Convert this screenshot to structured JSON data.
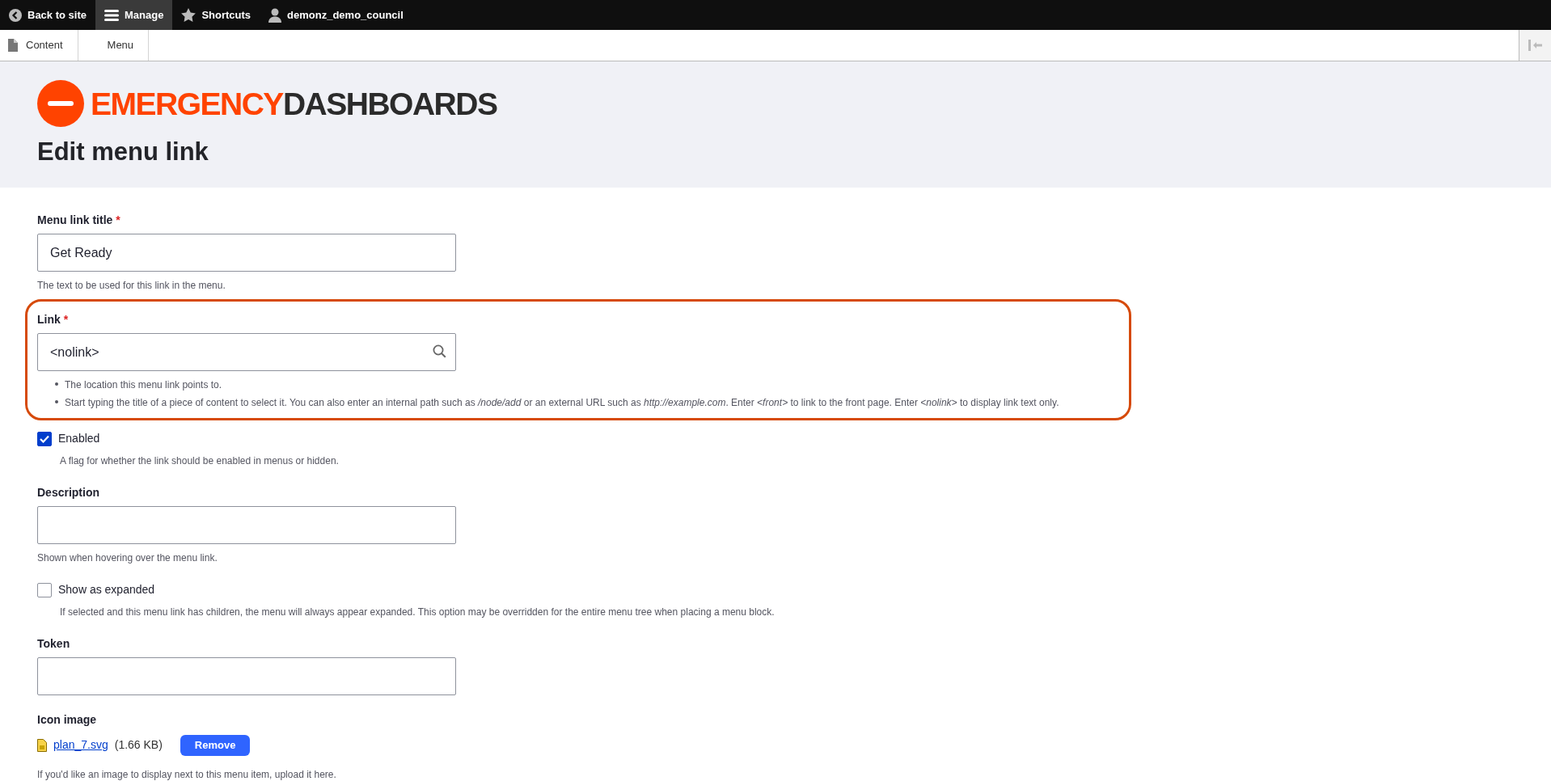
{
  "toolbar": {
    "items": [
      {
        "kind": "back",
        "label": "Back to site",
        "selected": false
      },
      {
        "kind": "menu",
        "label": "Manage",
        "selected": true
      },
      {
        "kind": "star",
        "label": "Shortcuts",
        "selected": false
      },
      {
        "kind": "user",
        "label": "demonz_demo_council",
        "selected": false
      }
    ]
  },
  "tray": {
    "items": [
      {
        "kind": "page",
        "label": "Content"
      },
      {
        "kind": "plain",
        "label": "Menu"
      }
    ]
  },
  "header": {
    "logo": {
      "parts": [
        {
          "text": "EMERGENCY",
          "color": "#ff4300"
        },
        {
          "text": "DASHBOARDS",
          "color": "#2b2b2b"
        }
      ]
    },
    "title": "Edit menu link"
  },
  "fields": [
    {
      "kind": "text",
      "label": "Menu link title",
      "required_mark": "*",
      "value": "Get Ready",
      "help": "The text to be used for this link in the menu."
    },
    {
      "kind": "text",
      "label": "Link",
      "required_mark": "*",
      "value": "<nolink>",
      "search": true,
      "highlighted": true,
      "help_items": [
        "The location this menu link points to.",
        "Start typing the title of a piece of content to select it. You can also enter an internal path such as */node/add* or an external URL such as *http://example.com*. Enter *<front>* to link to the front page. Enter *<nolink>* to display link text only."
      ]
    },
    {
      "kind": "checkbox",
      "label": "Enabled",
      "checked": true,
      "help": "A flag for whether the link should be enabled in menus or hidden."
    },
    {
      "kind": "text",
      "label": "Description",
      "help": "Shown when hovering over the menu link."
    },
    {
      "kind": "checkbox",
      "label": "Show as expanded",
      "checked": false,
      "help": "If selected and this menu link has children, the menu will always appear expanded. This option may be overridden for the entire menu tree when placing a menu block."
    },
    {
      "kind": "text",
      "label": "Token"
    },
    {
      "kind": "file",
      "label": "Icon image",
      "file_name": "plan_7.svg",
      "file_size": "(1.66 KB)",
      "button": "Remove",
      "help": "If you'd like an image to display next to this menu item, upload it here."
    }
  ]
}
